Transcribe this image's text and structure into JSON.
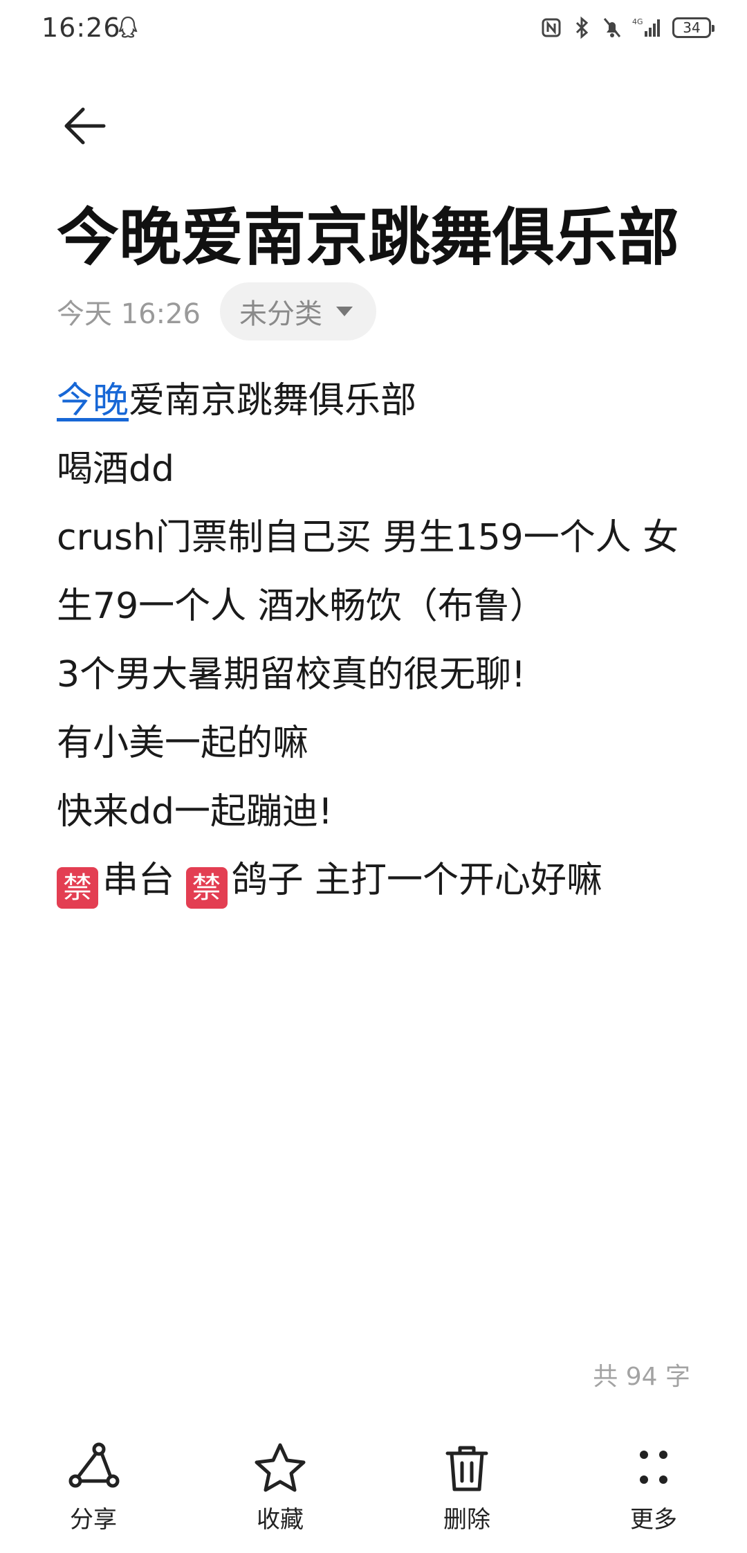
{
  "status_bar": {
    "time": "16:26",
    "network": "4G",
    "battery": "34"
  },
  "note": {
    "title": "今晚爱南京跳舞俱乐部",
    "date": "今天 16:26",
    "category": "未分类",
    "lines": [
      {
        "link": "今晚",
        "text": "爱南京跳舞俱乐部"
      },
      {
        "text": "喝酒dd"
      },
      {
        "text": "crush门票制自己买 男生159一个人 女"
      },
      {
        "text": "生79一个人 酒水畅饮（布鲁）"
      },
      {
        "text": "3个男大暑期留校真的很无聊!"
      },
      {
        "text": "有小美一起的嘛"
      },
      {
        "text": "快来dd一起蹦迪!"
      }
    ],
    "last_line": {
      "badge": "禁",
      "a": "串台 ",
      "b": "鸽子 主打一个开心好嘛"
    },
    "word_count": "共 94 字"
  },
  "toolbar": {
    "share": "分享",
    "favorite": "收藏",
    "delete": "删除",
    "more": "更多"
  }
}
